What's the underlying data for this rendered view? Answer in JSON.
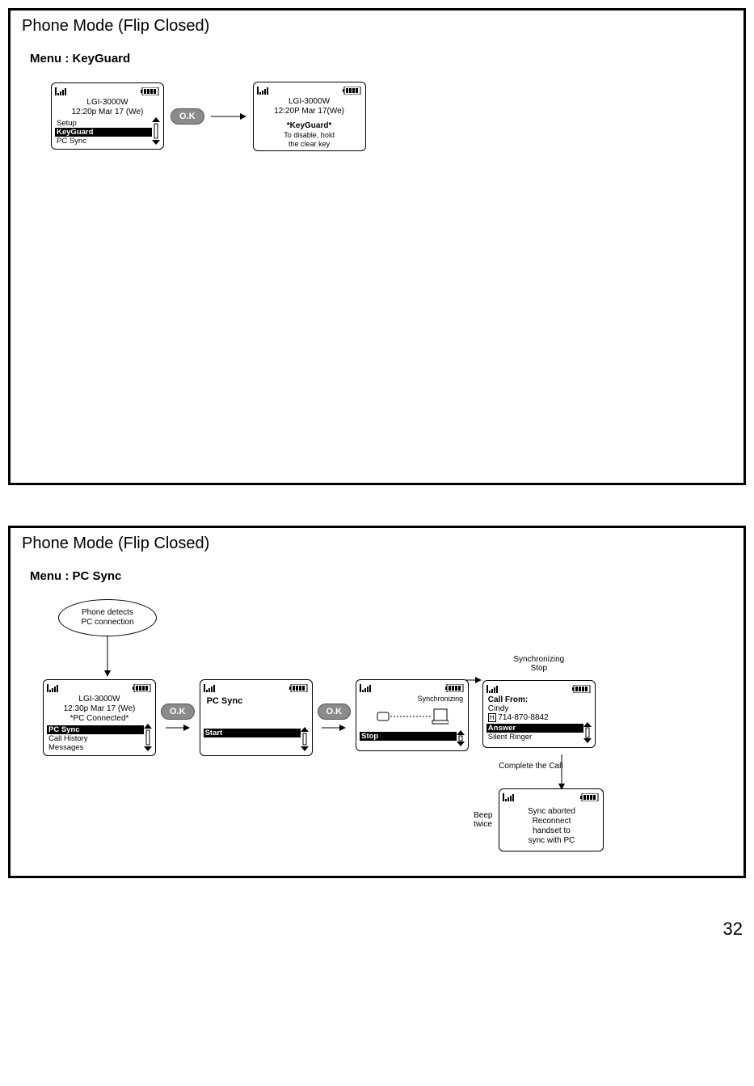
{
  "page_number": "32",
  "panel_keyguard": {
    "title": "Phone Mode (Flip Closed)",
    "menu_heading": "Menu : KeyGuard",
    "screen1": {
      "model": "LGI-3000W",
      "datetime": "12:20p Mar 17 (We)",
      "menu_items": [
        "Setup",
        "KeyGuard",
        "PC Sync"
      ],
      "selected_index": 1
    },
    "ok_label": "O.K",
    "screen2": {
      "model": "LGI-3000W",
      "datetime": "12:20P Mar 17(We)",
      "status_title": "*KeyGuard*",
      "status_line1": "To disable, hold",
      "status_line2": "the clear key"
    }
  },
  "panel_pcsync": {
    "title": "Phone Mode (Flip Closed)",
    "menu_heading": "Menu : PC Sync",
    "event_label_line1": "Phone detects",
    "event_label_line2": "PC connection",
    "screen1": {
      "model": "LGI-3000W",
      "datetime": "12:30p Mar 17 (We)",
      "status": "*PC Connected*",
      "menu_items": [
        "PC Sync",
        "Call History",
        "Messages"
      ],
      "selected_index": 0
    },
    "ok_label": "O.K",
    "screen2": {
      "title": "PC Sync",
      "action": "Start"
    },
    "screen3": {
      "status": "Synchronizing",
      "action": "Stop"
    },
    "top_label_line1": "Synchronizing",
    "top_label_line2": "Stop",
    "screen4": {
      "title": "Call From:",
      "caller": "Cindy",
      "caller_type": "H",
      "caller_number": "714-870-8842",
      "menu_items": [
        "Answer",
        "Silent Ringer"
      ],
      "selected_index": 0
    },
    "mid_label": "Complete the Call",
    "beep_label_line1": "Beep",
    "beep_label_line2": "twice",
    "screen5": {
      "line1": "Sync aborted",
      "line2": "Reconnect",
      "line3": "handset to",
      "line4": "sync with PC"
    }
  }
}
